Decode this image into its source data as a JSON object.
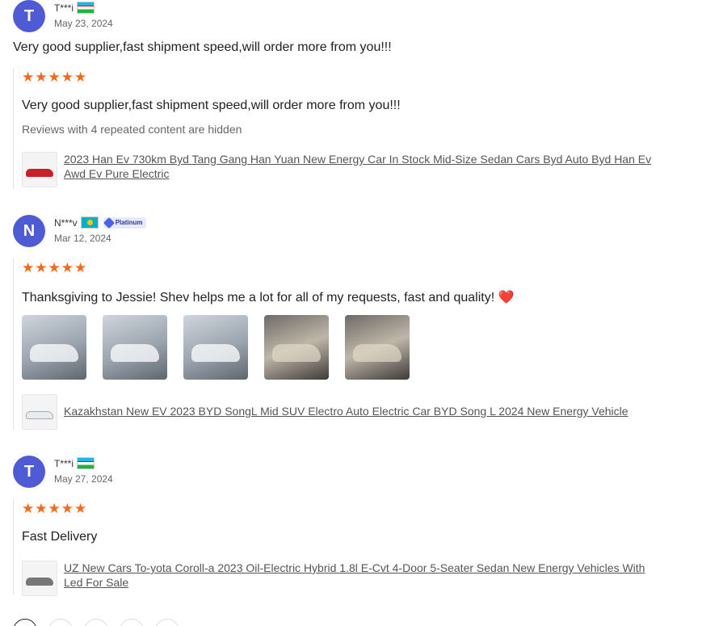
{
  "reviews": [
    {
      "avatar_letter": "T",
      "user": "T***i",
      "flag": "uz-flag-icon",
      "date": "May 23, 2024",
      "summary": "Very good supplier,fast shipment speed,will order more from you!!!",
      "stars": 5,
      "content": "Very good supplier,fast shipment speed,will order more from you!!!",
      "hidden_note": "Reviews with 4 repeated content are hidden",
      "product": "2023 Han Ev 730km Byd Tang Gang Han Yuan New Energy Car In Stock Mid-Size Sedan Cars Byd Auto Byd Han Ev Awd Ev Pure Electric"
    },
    {
      "avatar_letter": "N",
      "user": "N***v",
      "flag": "kz-flag-icon",
      "badge": "Platinum",
      "date": "Mar 12, 2024",
      "stars": 5,
      "content": "Thanksgiving to Jessie! Shev helps me a lot for all of my requests, fast and quality! ❤️",
      "photo_count": 5,
      "product": "Kazakhstan New EV 2023 BYD SongL Mid SUV Electro Auto Electric Car BYD Song L 2024 New Energy Vehicle"
    },
    {
      "avatar_letter": "T",
      "user": "T***i",
      "flag": "uz-flag-icon",
      "date": "May 27, 2024",
      "stars": 5,
      "content": "Fast Delivery",
      "product": "UZ New Cars To-yota Coroll-a 2023 Oil-Electric Hybrid 1.8l E-Cvt 4-Door 5-Seater Sedan New Energy Vehicles With Led For Sale"
    }
  ],
  "star_glyph": "★",
  "colors": {
    "avatar": "#4f5bd5",
    "star": "#f26a1b"
  }
}
